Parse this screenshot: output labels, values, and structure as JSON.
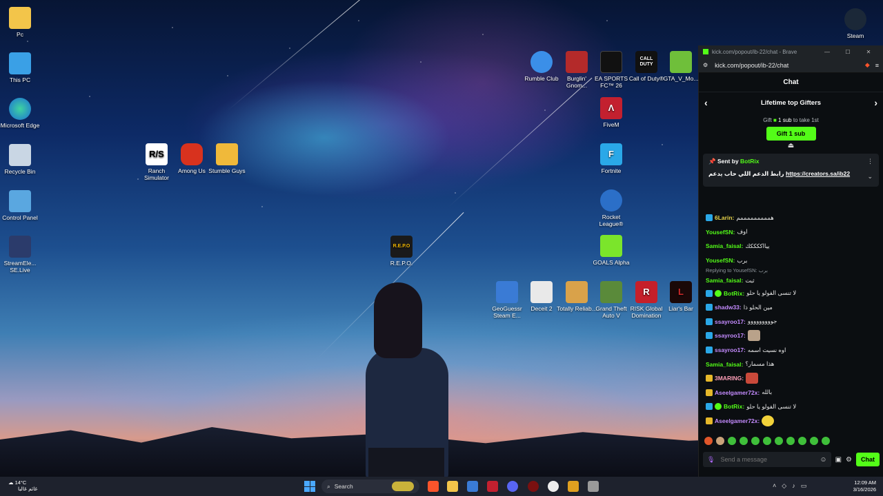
{
  "desktop_icons": {
    "pc": "Pc",
    "this_pc": "This PC",
    "edge": "Microsoft Edge",
    "recycle": "Recycle Bin",
    "control_panel": "Control Panel",
    "streamelements": "StreamEle... SE.Live",
    "ranch": "Ranch Simulator",
    "among_us": "Among Us",
    "stumble": "Stumble Guys",
    "repo": "R.E.P.O.",
    "rumble": "Rumble Club",
    "burglin": "Burglin' Gnom...",
    "easports": "EA SPORTS FC™ 26",
    "cod": "Call of Duty®",
    "gta_mods": "GTA_V_Mo...",
    "fivem": "FiveM",
    "fortnite": "Fortnite",
    "rocket": "Rocket League®",
    "goals": "GOALS Alpha",
    "geoguessr": "GeoGuessr Steam E...",
    "deceit": "Deceit 2",
    "totally": "Totally Reliab...",
    "gta5": "Grand Theft Auto V",
    "risk": "RISK Global Domination",
    "liars": "Liar's Bar",
    "steam": "Steam",
    "repo_logo": "R.E.P.O",
    "ranch_logo": "R/S",
    "cod_logo": "CALL DUTY",
    "fortnite_logo": "F",
    "fivem_logo": "Λ",
    "risk_logo": "R",
    "liars_logo": "L"
  },
  "chat_window": {
    "window_title": "kick.com/popout/ib-22/chat - Brave",
    "url": "kick.com/popout/ib-22/chat",
    "minimize": "—",
    "maximize": "☐",
    "close": "✕",
    "chat_title": "Chat",
    "gifters_title": "Lifetime top Gifters",
    "gift_prompt_pre": "Gift",
    "gift_prompt_count": "1 sub",
    "gift_prompt_post": "to take 1st",
    "gift_button": "Gift 1 sub",
    "pinned": {
      "sent_by": "Sent by",
      "sender": "BotRix",
      "text": "رابط الدعم اللي حاب يدعم",
      "link": "https://creators.sa/ib22"
    },
    "reply_to": "Replying to YousefSN: برب",
    "messages": [
      {
        "user": "6Larin:",
        "text": "همممممممممم",
        "color": "#e6d24a"
      },
      {
        "user": "YousefSN:",
        "text": "اوف",
        "color": "#53fc18"
      },
      {
        "user": "Samia_faisal:",
        "text": "ييااككككك",
        "color": "#53fc18"
      },
      {
        "user": "YousefSN:",
        "text": "برب",
        "color": "#53fc18"
      },
      {
        "user": "Samia_faisal:",
        "text": "ثبت",
        "color": "#53fc18"
      },
      {
        "user": "BotRix:",
        "text": "لا تنسى الفولو يا حلو",
        "color": "#53fc18"
      },
      {
        "user": "shadw33:",
        "text": "مين الحلو ذا",
        "color": "#c48bff"
      },
      {
        "user": "ssayroo17:",
        "text": "جووووووووو",
        "color": "#c48bff"
      },
      {
        "user": "ssayroo17:",
        "text": "",
        "color": "#c48bff"
      },
      {
        "user": "ssayroo17:",
        "text": "اوه نسيت اسمه",
        "color": "#c48bff"
      },
      {
        "user": "Samia_faisal:",
        "text": "هذا مسمار؟",
        "color": "#53fc18"
      },
      {
        "user": "3MARING:",
        "text": "",
        "color": "#ff9fb8"
      },
      {
        "user": "Aseelgamer72x:",
        "text": "بالله",
        "color": "#c48bff"
      },
      {
        "user": "BotRix:",
        "text": "لا تنسى الفولو يا حلو",
        "color": "#53fc18"
      },
      {
        "user": "Aseelgamer72x:",
        "text": "",
        "color": "#c48bff"
      }
    ],
    "input_placeholder": "Send a message",
    "send_button": "Chat"
  },
  "taskbar": {
    "weather_temp": "14°C",
    "weather_desc": "غائم غالبا",
    "search_label": "Search",
    "time": "12:09 AM",
    "date": "3/16/2026"
  },
  "colors": {
    "kick_green": "#53fc18",
    "chat_bg": "#0b0e11"
  }
}
